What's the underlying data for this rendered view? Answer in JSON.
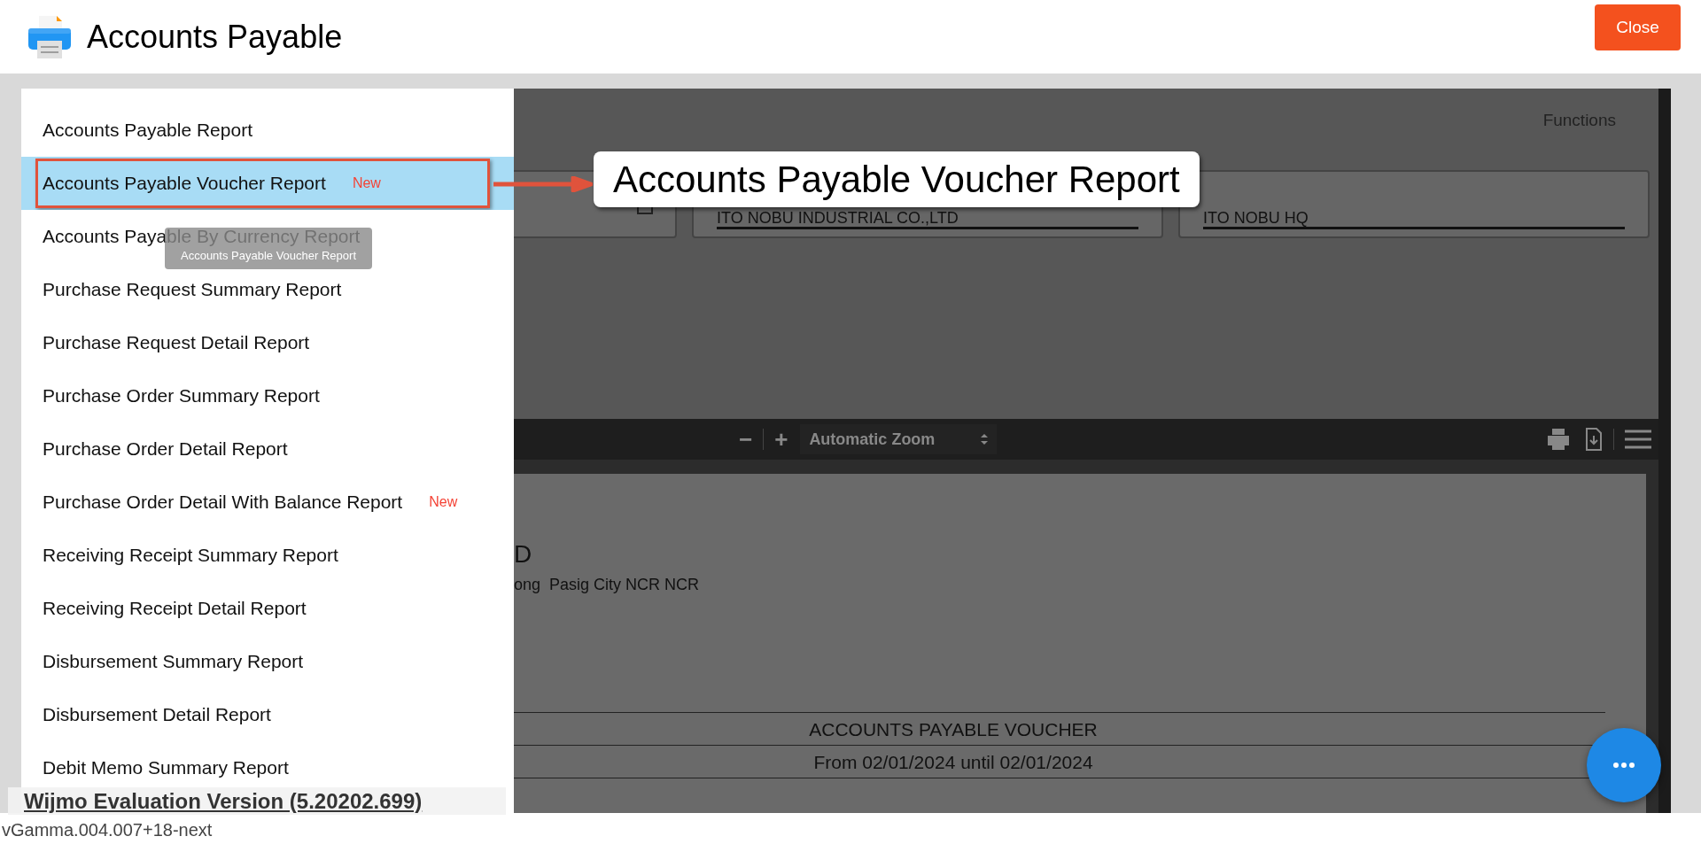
{
  "header": {
    "title": "Accounts Payable",
    "close_label": "Close"
  },
  "page": {
    "functions_label": "Functions",
    "fields": [
      {
        "value": "ITO NOBU INDUSTRIAL CO.,LTD"
      },
      {
        "value": "ITO NOBU HQ"
      }
    ]
  },
  "pdf_viewer": {
    "zoom_out": "−",
    "zoom_in": "+",
    "zoom_select": "Automatic Zoom",
    "document": {
      "company_fragment": "D",
      "address_fragment": "ong  Pasig City NCR NCR",
      "report_title": "ACCOUNTS PAYABLE VOUCHER",
      "date_range": "From 02/01/2024 until 02/01/2024"
    }
  },
  "report_menu": {
    "items": [
      {
        "label": "Accounts Payable Report",
        "selected": false
      },
      {
        "label": "Accounts Payable Voucher Report",
        "selected": true,
        "badge": "New"
      },
      {
        "label": "Accounts Payable By Currency Report",
        "selected": false
      },
      {
        "label": "Purchase Request Summary Report",
        "selected": false
      },
      {
        "label": "Purchase Request Detail Report",
        "selected": false
      },
      {
        "label": "Purchase Order Summary Report",
        "selected": false
      },
      {
        "label": "Purchase Order Detail Report",
        "selected": false
      },
      {
        "label": "Purchase Order Detail With Balance Report",
        "selected": false,
        "badge": "New"
      },
      {
        "label": "Receiving Receipt Summary Report",
        "selected": false
      },
      {
        "label": "Receiving Receipt Detail Report",
        "selected": false
      },
      {
        "label": "Disbursement Summary Report",
        "selected": false
      },
      {
        "label": "Disbursement Detail Report",
        "selected": false
      },
      {
        "label": "Debit Memo Summary Report",
        "selected": false
      }
    ]
  },
  "tooltip": "Accounts Payable Voucher Report",
  "callout": {
    "text": "Accounts Payable Voucher Report"
  },
  "watermark": "Wijmo Evaluation Version (5.20202.699)",
  "version": "vGamma.004.007+18-next"
}
